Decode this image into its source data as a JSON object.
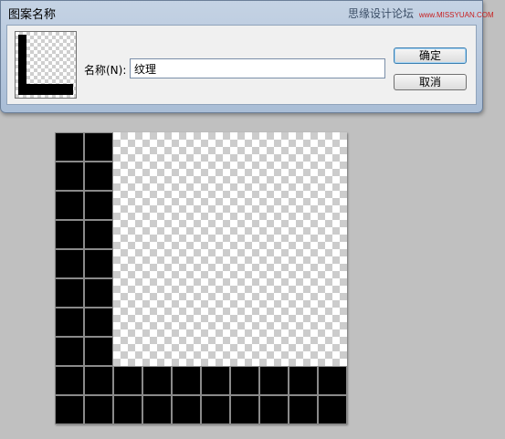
{
  "dialog": {
    "title": "图案名称",
    "watermark_text": "思缘设计论坛",
    "watermark_url": "www.MISSYUAN.COM",
    "name_label": "名称(N):",
    "name_value": "纹理",
    "ok_label": "确定",
    "cancel_label": "取消"
  },
  "canvas": {
    "pattern": "L-shaped black grid on transparent checkerboard",
    "grid_columns": 10,
    "grid_rows": 10,
    "fill_color": "#000000",
    "grid_line_color": "#8a8a8a"
  }
}
